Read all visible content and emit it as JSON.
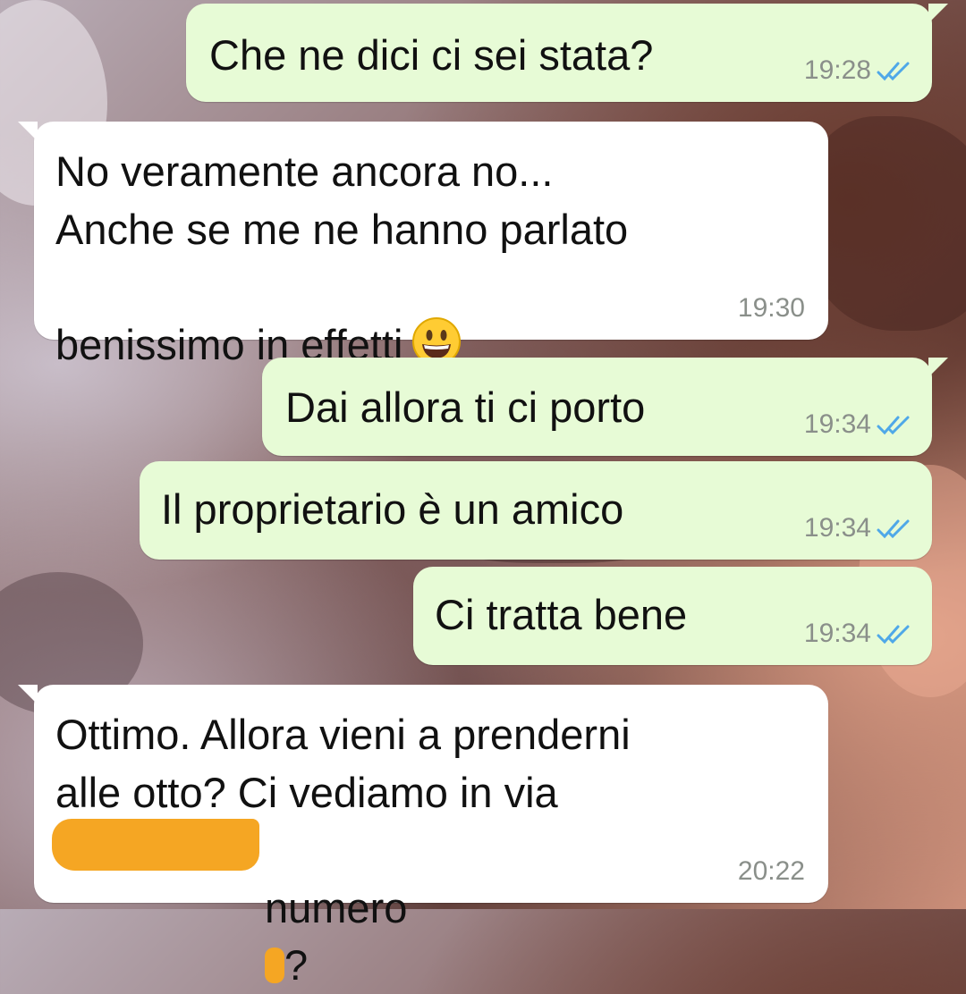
{
  "colors": {
    "outgoing_bubble": "#e7fbd6",
    "incoming_bubble": "#ffffff",
    "read_ticks": "#4fa8e8",
    "timestamp": "#8a8f8a",
    "redaction": "#f5a623"
  },
  "messages": [
    {
      "direction": "outgoing",
      "text": "Che ne dici ci sei stata?",
      "time": "19:28",
      "status": "read-double-check-icon"
    },
    {
      "direction": "incoming",
      "line1": "No veramente ancora no...",
      "line2": "Anche se me ne hanno parlato",
      "line3": "benissimo in effetti",
      "emoji": "grinning-face-icon",
      "time": "19:30"
    },
    {
      "direction": "outgoing",
      "text": "Dai allora ti ci porto",
      "time": "19:34",
      "status": "read-double-check-icon"
    },
    {
      "direction": "outgoing",
      "text": "Il proprietario è un amico",
      "time": "19:34",
      "status": "read-double-check-icon"
    },
    {
      "direction": "outgoing",
      "text": "Ci tratta bene",
      "time": "19:34",
      "status": "read-double-check-icon"
    },
    {
      "direction": "incoming",
      "line1": "Ottimo. Allora vieni a prenderni",
      "line2": "alle otto? Ci vediamo in via",
      "line3_tail": "numero",
      "line3_end": "?",
      "time": "20:22"
    }
  ]
}
